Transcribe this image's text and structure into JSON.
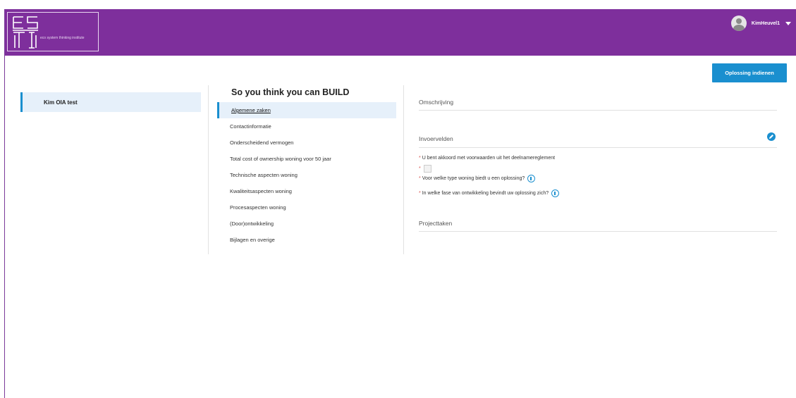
{
  "header": {
    "logo_letters": "ESTI",
    "logo_subtitle": "eco system thinking institute",
    "user_name": "KimHeuvel1"
  },
  "toolbar": {
    "submit_label": "Oplossing indienen"
  },
  "projects": {
    "items": [
      {
        "label": "Kim OIA test"
      }
    ]
  },
  "nav": {
    "title": "So you think you can BUILD",
    "items": [
      {
        "label": "Algemene zaken",
        "active": true
      },
      {
        "label": "Contactinformatie"
      },
      {
        "label": "Onderscheidend vermogen"
      },
      {
        "label": "Total cost of ownership woning voor 50 jaar"
      },
      {
        "label": "Technische aspecten woning"
      },
      {
        "label": "Kwaliteitsaspecten woning"
      },
      {
        "label": "Procesaspecten woning"
      },
      {
        "label": "(Door)ontwikkeling"
      },
      {
        "label": "Bijlagen en overige"
      }
    ]
  },
  "content": {
    "description_title": "Omschrijving",
    "fields_title": "Invoervelden",
    "fields": [
      {
        "required": "*",
        "label": "U bent akkoord met voorwaarden uit het deelnamereglement"
      },
      {
        "required": "*",
        "label": "Voor welke type woning biedt u een oplossing?"
      },
      {
        "required": "*",
        "label": "In welke fase van ontwikkeling bevindt uw oplossing zich?"
      }
    ],
    "tasks_title": "Projecttaken"
  },
  "colors": {
    "header": "#7e2f9c",
    "accent": "#1a8fcf",
    "active_bg": "#e6f0fa",
    "required": "#d9534f"
  }
}
